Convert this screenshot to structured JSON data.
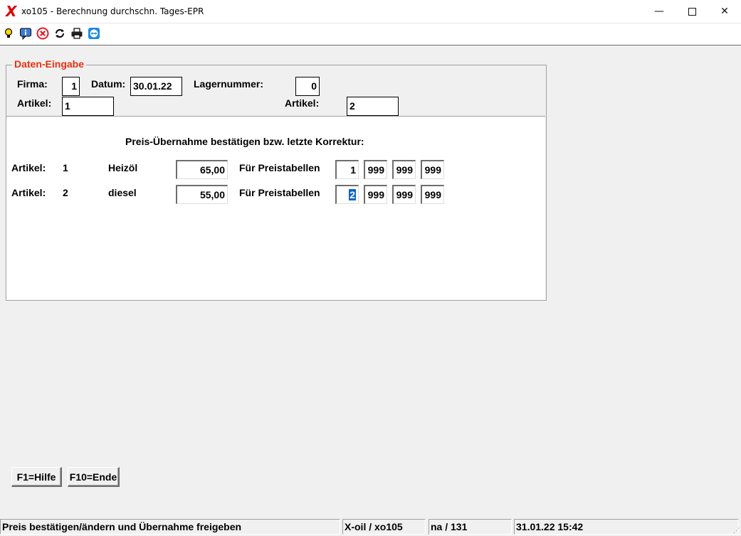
{
  "window": {
    "title": "xo105 - Berechnung durchschn. Tages-EPR",
    "logo_glyph": "X",
    "minimize_glyph": "—",
    "close_glyph": "✕"
  },
  "toolbar": {
    "icons": [
      "lightbulb-icon",
      "info-icon",
      "cancel-icon",
      "refresh-icon",
      "print-icon",
      "teamviewer-icon"
    ]
  },
  "form": {
    "group_title": "Daten-Eingabe",
    "firma_label": "Firma:",
    "firma_value": "1",
    "datum_label": "Datum:",
    "datum_value": "30.01.22",
    "lagernummer_label": "Lagernummer:",
    "lagernummer_value": "0",
    "artikel_from_label": "Artikel:",
    "artikel_from_value": "1",
    "artikel_to_label": "Artikel:",
    "artikel_to_value": "2"
  },
  "confirm": {
    "heading": "Preis-Übernahme bestätigen bzw. letzte Korrektur:",
    "rows": [
      {
        "label": "Artikel:",
        "number": "1",
        "name": "Heizöl",
        "price": "65,00",
        "tables_label": "Für Preistabellen",
        "tables": [
          "1",
          "999",
          "999",
          "999"
        ]
      },
      {
        "label": "Artikel:",
        "number": "2",
        "name": "diesel",
        "price": "55,00",
        "tables_label": "Für Preistabellen",
        "tables": [
          "2",
          "999",
          "999",
          "999"
        ]
      }
    ]
  },
  "buttons": {
    "help": "F1=Hilfe",
    "end": "F10=Ende"
  },
  "status": {
    "message": "Preis bestätigen/ändern und Übernahme freigeben",
    "program": "X-oil / xo105",
    "user": "na / 131",
    "datetime": "31.01.22 15:42"
  },
  "colors": {
    "legend": "#e8300c",
    "logo": "#e00000",
    "selection": "#0a64c8"
  }
}
